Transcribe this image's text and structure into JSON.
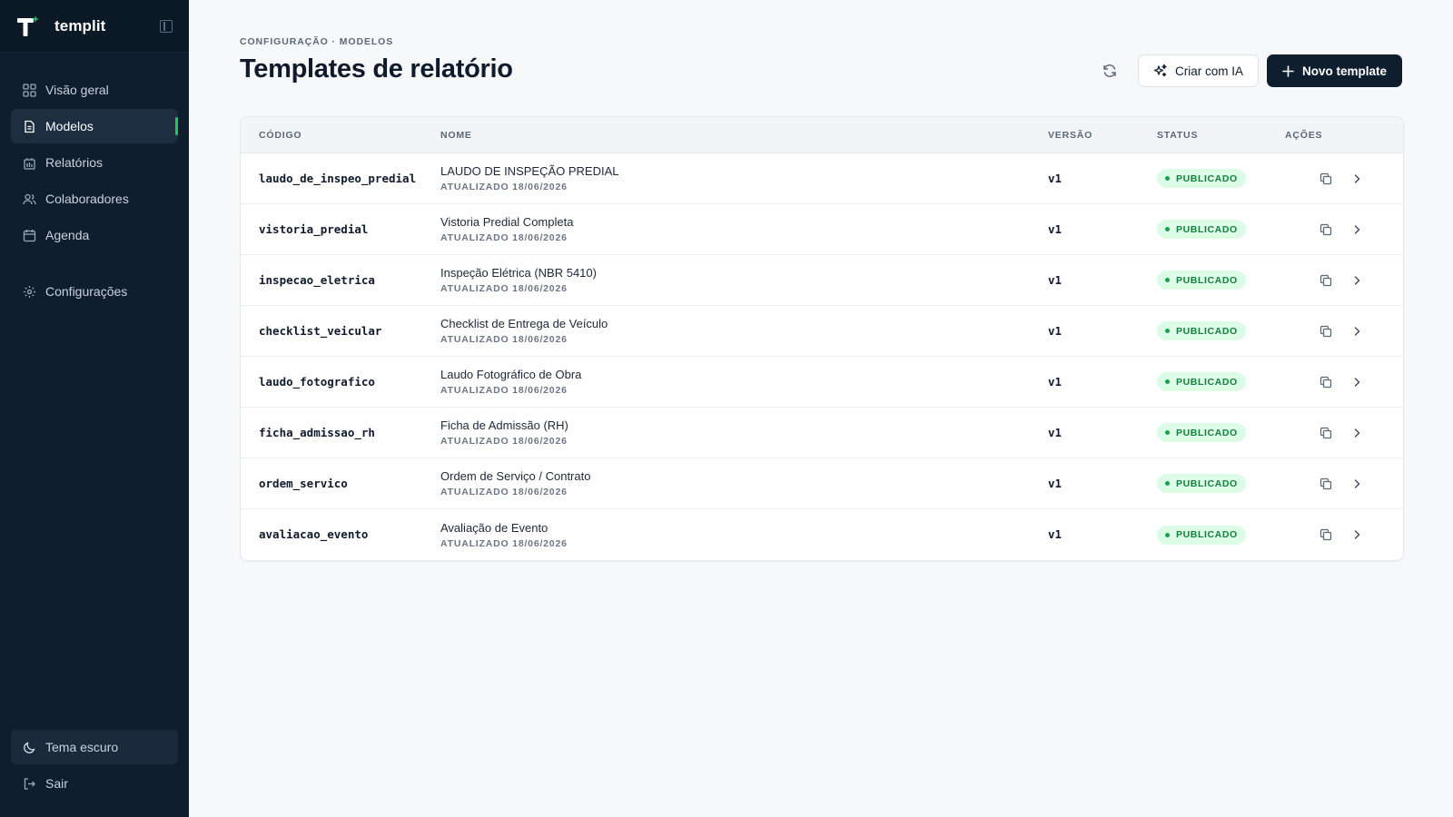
{
  "app": {
    "name": "templit"
  },
  "sidebar": {
    "items": [
      {
        "label": "Visão geral",
        "icon": "grid-icon"
      },
      {
        "label": "Modelos",
        "icon": "document-icon",
        "active": true
      },
      {
        "label": "Relatórios",
        "icon": "report-icon"
      },
      {
        "label": "Colaboradores",
        "icon": "users-icon"
      },
      {
        "label": "Agenda",
        "icon": "calendar-icon"
      }
    ],
    "settings": {
      "label": "Configurações",
      "icon": "gear-icon"
    },
    "theme": {
      "label": "Tema escuro",
      "icon": "moon-icon"
    },
    "logout": {
      "label": "Sair",
      "icon": "logout-icon"
    }
  },
  "header": {
    "breadcrumb": "CONFIGURAÇÃO · MODELOS",
    "title": "Templates de relatório",
    "ai_button": "Criar com IA",
    "new_button": "Novo template"
  },
  "table": {
    "columns": {
      "code": "CÓDIGO",
      "name": "NOME",
      "version": "VERSÃO",
      "status": "STATUS",
      "actions": "AÇÕES"
    },
    "rows": [
      {
        "code": "laudo_de_inspeo_predial",
        "name": "LAUDO DE INSPEÇÃO PREDIAL",
        "updated": "ATUALIZADO 18/06/2026",
        "version": "v1",
        "status": "PUBLICADO"
      },
      {
        "code": "vistoria_predial",
        "name": "Vistoria Predial Completa",
        "updated": "ATUALIZADO 18/06/2026",
        "version": "v1",
        "status": "PUBLICADO"
      },
      {
        "code": "inspecao_eletrica",
        "name": "Inspeção Elétrica (NBR 5410)",
        "updated": "ATUALIZADO 18/06/2026",
        "version": "v1",
        "status": "PUBLICADO"
      },
      {
        "code": "checklist_veicular",
        "name": "Checklist de Entrega de Veículo",
        "updated": "ATUALIZADO 18/06/2026",
        "version": "v1",
        "status": "PUBLICADO"
      },
      {
        "code": "laudo_fotografico",
        "name": "Laudo Fotográfico de Obra",
        "updated": "ATUALIZADO 18/06/2026",
        "version": "v1",
        "status": "PUBLICADO"
      },
      {
        "code": "ficha_admissao_rh",
        "name": "Ficha de Admissão (RH)",
        "updated": "ATUALIZADO 18/06/2026",
        "version": "v1",
        "status": "PUBLICADO"
      },
      {
        "code": "ordem_servico",
        "name": "Ordem de Serviço / Contrato",
        "updated": "ATUALIZADO 18/06/2026",
        "version": "v1",
        "status": "PUBLICADO"
      },
      {
        "code": "avaliacao_evento",
        "name": "Avaliação de Evento",
        "updated": "ATUALIZADO 18/06/2026",
        "version": "v1",
        "status": "PUBLICADO"
      }
    ]
  },
  "colors": {
    "sidebar_bg": "#0f1e2e",
    "accent_green": "#22c55e",
    "badge_bg": "#dcfce7",
    "badge_text": "#15803d",
    "primary_button": "#0f1e2e"
  }
}
